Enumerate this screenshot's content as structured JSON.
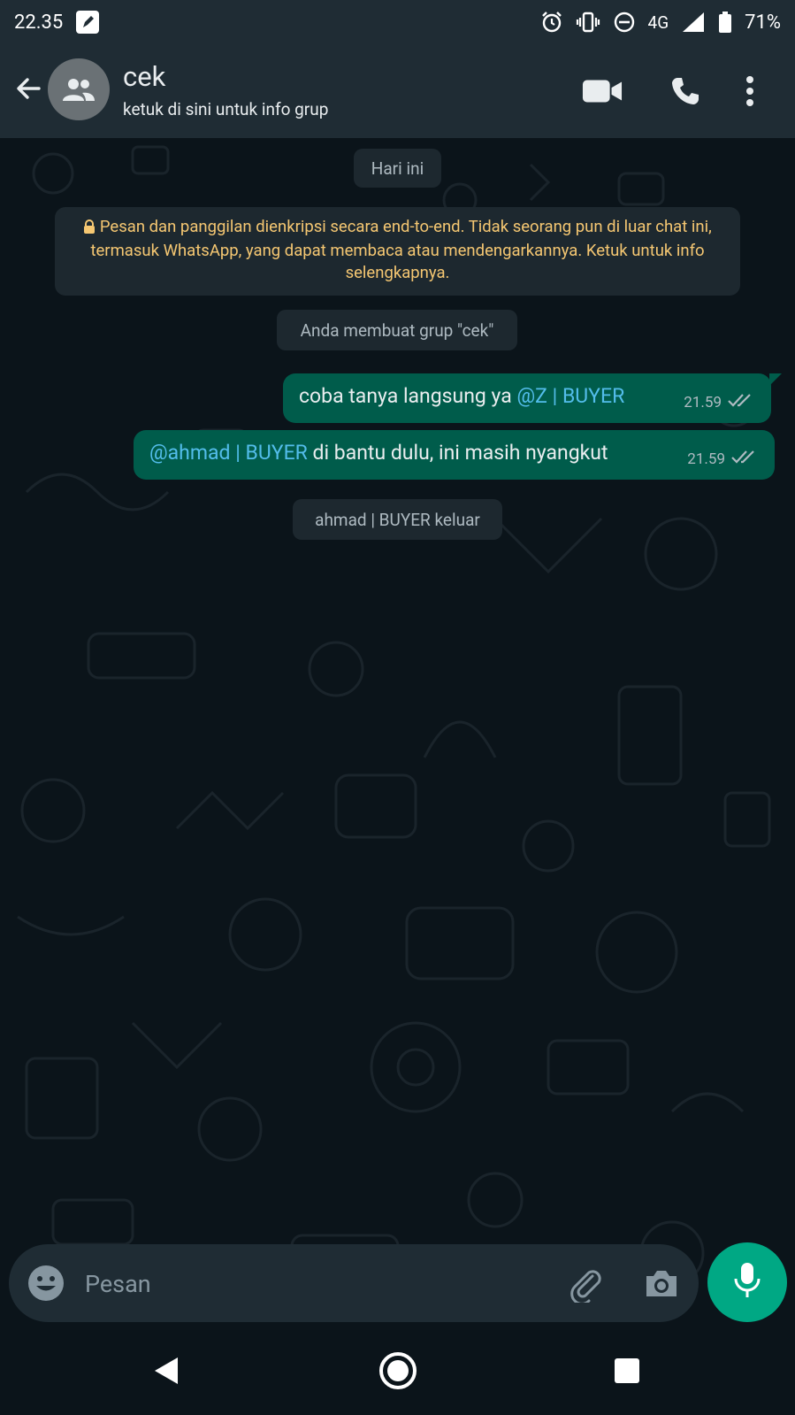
{
  "status_bar": {
    "time": "22.35",
    "network": "4G",
    "battery": "71%",
    "icons": [
      "edit-app-icon",
      "alarm-icon",
      "vibrate-icon",
      "do-not-disturb-icon",
      "signal-icon",
      "battery-icon"
    ]
  },
  "header": {
    "title": "cek",
    "subtitle": "ketuk di sini untuk info grup",
    "icons": [
      "back-arrow-icon",
      "group-avatar-icon",
      "video-call-icon",
      "phone-call-icon",
      "more-options-icon"
    ]
  },
  "chat": {
    "date_label": "Hari ini",
    "encryption_notice": "Pesan dan panggilan dienkripsi secara end-to-end. Tidak seorang pun di luar chat ini, termasuk WhatsApp, yang dapat membaca atau mendengarkannya. Ketuk untuk info selengkapnya.",
    "system_created": "Anda membuat grup \"cek\"",
    "messages": [
      {
        "text_before": "coba tanya langsung ya ",
        "mention": "@Z | BUYER",
        "text_after": "",
        "time": "21.59",
        "status": "double-check-icon"
      },
      {
        "text_before": "",
        "mention": "@ahmad | BUYER",
        "text_after": " di bantu dulu, ini masih nyangkut",
        "time": "21.59",
        "status": "double-check-icon"
      }
    ],
    "system_left": "ahmad | BUYER keluar"
  },
  "composer": {
    "placeholder": "Pesan",
    "value": "",
    "icons": [
      "emoji-icon",
      "attach-icon",
      "camera-icon",
      "mic-icon"
    ]
  },
  "colors": {
    "bar_bg": "#1f2c34",
    "chat_bg": "#0b141a",
    "outgoing_bubble": "#005c4b",
    "mention": "#53bdeb",
    "notice_text": "#f5c772",
    "accent": "#00a884"
  }
}
